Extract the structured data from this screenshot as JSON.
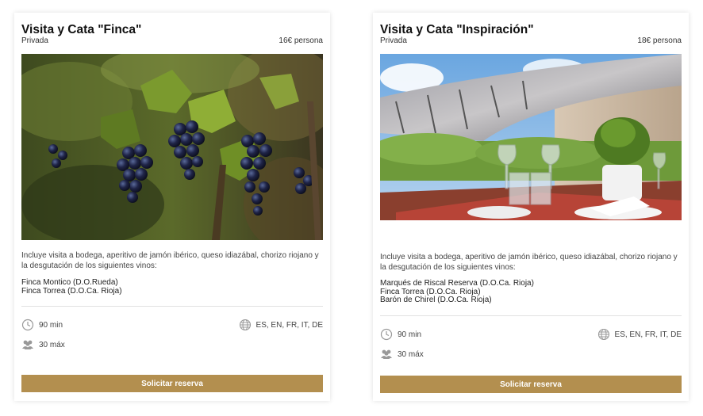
{
  "accent": "#b38f4f",
  "cards": [
    {
      "title": "Visita y Cata \"Finca\"",
      "type": "Privada",
      "price": "16€ persona",
      "image": "vineyard-grapes",
      "description": "Incluye visita a bodega, aperitivo de jamón ibérico, queso idiazábal, chorizo riojano y la desgutación de los siguientes vinos:",
      "wines": [
        "Finca Montico (D.O.Rueda)",
        "Finca Torrea (D.O.Ca. Rioja)"
      ],
      "duration": "90 min",
      "capacity": "30 máx",
      "languages": "ES, EN, FR, IT, DE",
      "button": "Solicitar reserva"
    },
    {
      "title": "Visita y Cata \"Inspiración\"",
      "type": "Privada",
      "price": "18€ persona",
      "image": "terrace-dining",
      "description": "Incluye visita a bodega, aperitivo de jamón ibérico, queso idiazábal, chorizo riojano y la desgutación de los siguientes vinos:",
      "wines": [
        "Marqués de Riscal Reserva (D.O.Ca. Rioja)",
        "Finca Torrea (D.O.Ca. Rioja)",
        "Barón de Chirel (D.O.Ca. Rioja)"
      ],
      "duration": "90 min",
      "capacity": "30 máx",
      "languages": "ES, EN, FR, IT, DE",
      "button": "Solicitar reserva"
    }
  ]
}
